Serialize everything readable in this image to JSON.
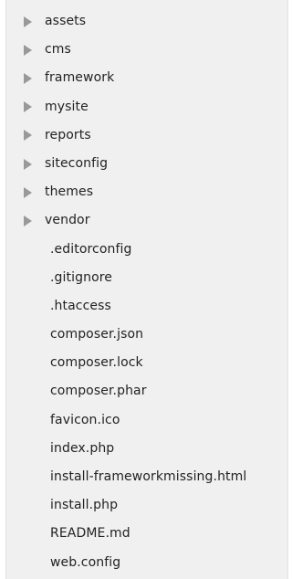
{
  "tree": {
    "folders": [
      {
        "label": "assets",
        "icon": "chevron-right-icon"
      },
      {
        "label": "cms",
        "icon": "chevron-right-icon"
      },
      {
        "label": "framework",
        "icon": "chevron-right-icon"
      },
      {
        "label": "mysite",
        "icon": "chevron-right-icon"
      },
      {
        "label": "reports",
        "icon": "chevron-right-icon"
      },
      {
        "label": "siteconfig",
        "icon": "chevron-right-icon"
      },
      {
        "label": "themes",
        "icon": "chevron-right-icon"
      },
      {
        "label": "vendor",
        "icon": "chevron-right-icon"
      }
    ],
    "files": [
      {
        "label": ".editorconfig"
      },
      {
        "label": ".gitignore"
      },
      {
        "label": ".htaccess"
      },
      {
        "label": "composer.json"
      },
      {
        "label": "composer.lock"
      },
      {
        "label": "composer.phar"
      },
      {
        "label": "favicon.ico"
      },
      {
        "label": "index.php"
      },
      {
        "label": "install-frameworkmissing.html"
      },
      {
        "label": "install.php"
      },
      {
        "label": "README.md"
      },
      {
        "label": "web.config"
      }
    ],
    "colors": {
      "panel_background": "#f0f0f0",
      "text": "#222222",
      "chevron": "#999999"
    }
  }
}
